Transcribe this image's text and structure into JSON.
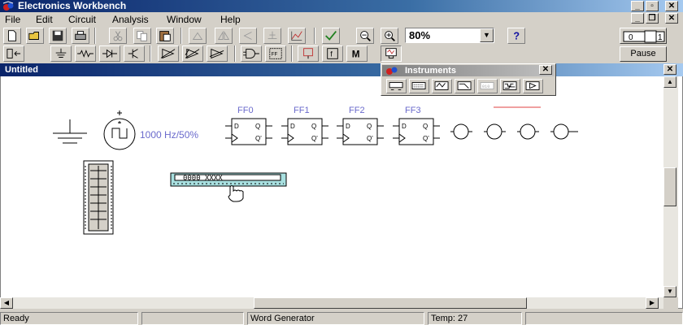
{
  "app": {
    "title": "Electronics Workbench"
  },
  "menu": [
    "File",
    "Edit",
    "Circuit",
    "Analysis",
    "Window",
    "Help"
  ],
  "toolbar": {
    "zoom_value": "80%",
    "pause_label": "Pause"
  },
  "document": {
    "title": "Untitled"
  },
  "instruments": {
    "title": "Instruments"
  },
  "canvas": {
    "source_label": "1000 Hz/50%",
    "flipflops": [
      "FF0",
      "FF1",
      "FF2",
      "FF3"
    ],
    "ff_pins": {
      "d": "D",
      "q": "Q",
      "qbar": "Q'"
    },
    "word_generator_display": "0000  XXXX"
  },
  "status": {
    "ready": "Ready",
    "component": "Word Generator",
    "temp": "Temp:  27"
  },
  "colors": {
    "title_active": "#0a246a",
    "label": "#6a6acc",
    "wire_red": "#e04040"
  }
}
